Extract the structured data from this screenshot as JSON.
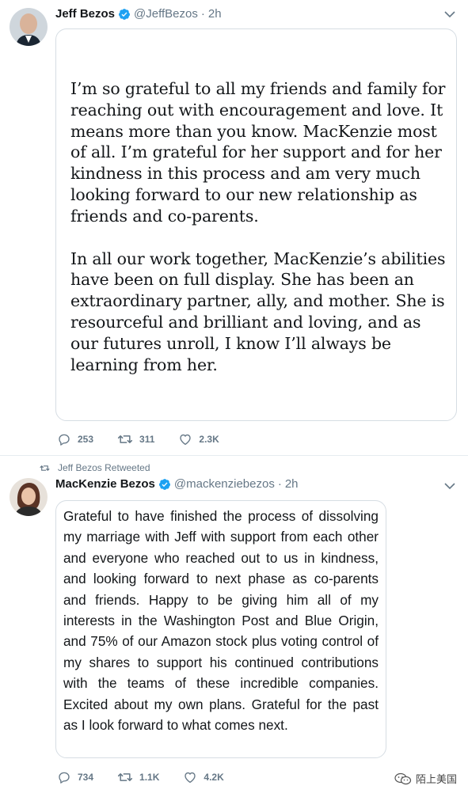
{
  "tweets": [
    {
      "author_name": "Jeff Bezos",
      "handle": "@JeffBezos",
      "separator": "·",
      "time": "2h",
      "statement_paragraphs": [
        "I’m so grateful to all my friends and family for reaching out with encouragement and love. It means more than you know. MacKenzie most of all. I’m grateful for her support and for her kindness in this process and am very much looking forward to our new relationship as friends and co-parents.",
        "In all our work together, MacKenzie’s abilities have been on full display. She has been an extraordinary partner, ally, and mother. She is resourceful and brilliant and loving, and as our futures unroll, I know I’ll always be learning from her."
      ],
      "replies": "253",
      "retweets": "311",
      "likes": "2.3K"
    },
    {
      "retweeted_by": "Jeff Bezos Retweeted",
      "author_name": "MacKenzie Bezos",
      "handle": "@mackenziebezos",
      "separator": "·",
      "time": "2h",
      "text": "Grateful to have finished the process of dissolving my marriage with Jeff with support from each other and everyone who reached out to us in kindness, and looking forward to next phase as co-parents and friends.  Happy to be giving him all of my interests in the Washington Post and Blue Origin, and 75% of our Amazon stock plus voting control of my shares to support his continued contributions with the teams of these incredible companies.  Excited about my own plans.  Grateful for the past as I look forward to what comes next.",
      "replies": "734",
      "retweets": "1.1K",
      "likes": "4.2K"
    }
  ],
  "watermark": "陌上美国",
  "colors": {
    "verified": "#1da1f2",
    "muted": "#657786",
    "border": "#e6ecf0"
  }
}
